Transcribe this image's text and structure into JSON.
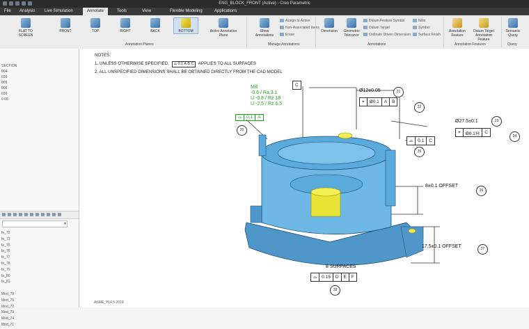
{
  "window": {
    "title": "ENG_BLOCK_FRONT (Active) - Creo Parametric"
  },
  "tabs": [
    "File",
    "Analysis",
    "Live Simulation",
    "Annotate",
    "Tools",
    "View",
    "Flexible Modeling",
    "Applications"
  ],
  "ribbon": {
    "views": [
      "FLAT TO SCREEN",
      "FRONT",
      "TOP",
      "RIGHT",
      "BACK",
      "BOTTOM"
    ],
    "active_annotation_plane": "Active Annotation Plane",
    "group_annotation_planes": "Annotation Planes",
    "show_annotations": "Show Annotations",
    "manage_small": [
      "Assign to Active",
      "Non-Associated Items",
      "Erase"
    ],
    "group_manage": "Manage Annotations",
    "dimension": "Dimension",
    "geometric_tolerance": "Geometric Tolerance",
    "annot_small": [
      "Datum Feature Symbol",
      "Datum Target",
      "Ordinate Driven Dimension",
      "Note",
      "Symbol",
      "Surface Finish"
    ],
    "group_annotations": "Annotations",
    "annotation_feature": "Annotation Feature",
    "datum_target_feature": "Datum Target Annotation Feature",
    "group_annotation_features": "Annotation Features",
    "semantic_query": "Semantic Query",
    "group_query": "Query"
  },
  "tree": [
    "SECTION",
    "004",
    "030",
    "009",
    "006",
    "030",
    "0 08"
  ],
  "list2": [
    "fe_72",
    "fe_73",
    "fe_75",
    "fe_76",
    "fe_77",
    "fe_78",
    "fe_79",
    "fe_80",
    "fe_81",
    "",
    "Mod_70",
    "Mod_75",
    "Mod_72",
    "Mod_73",
    "Mod_74",
    "Mod_71"
  ],
  "notes": {
    "header": "NOTES:",
    "line1_a": "1. UNLESS OTHERWISE SPECIFIED,",
    "line1_fcf": [
      "⌓",
      "0.1",
      "A",
      "B",
      "C"
    ],
    "line1_b": "APPLIES TO ALL SURFACES",
    "line2": "2. ALL UNSPECIFIED DIMENSIONS SHALL BE OBTAINED DIRECTLY FROM THE CAD MODEL"
  },
  "annotations": {
    "datum_c": "C",
    "dia12": "Ø12±0.05",
    "dia12_fcf": [
      "⌖",
      "Ø0.1",
      "A",
      "B"
    ],
    "tag21": "21",
    "tag22": "22",
    "dia27": "Ø27.5±0.1",
    "dia27_fcf": [
      "⌖",
      "Ø0.1Ⓜ",
      "C"
    ],
    "tag23": "23",
    "tag24": "24",
    "profile_fcf": [
      "⌓",
      "0.1",
      "C"
    ],
    "tag25": "25",
    "mill": [
      "Mill",
      "-0.6 / Ra 3.1",
      "U -0.8 / Rz 18",
      "U -2.5 / Rz 6.5"
    ],
    "green_fcf": [
      "⌓",
      "0.1",
      "A"
    ],
    "tag20": "20",
    "offset1": "8±0.1 OFFSET",
    "tag26": "26",
    "offset2": "17.5±0.1 OFFSET",
    "tag27": "27",
    "surfaces": "8 SURFACES",
    "surfaces_fcf": [
      "⌓",
      "0.15",
      "D",
      "E",
      "F"
    ],
    "tag28": "28"
  },
  "footer": "ASME_Y14.5-2018"
}
